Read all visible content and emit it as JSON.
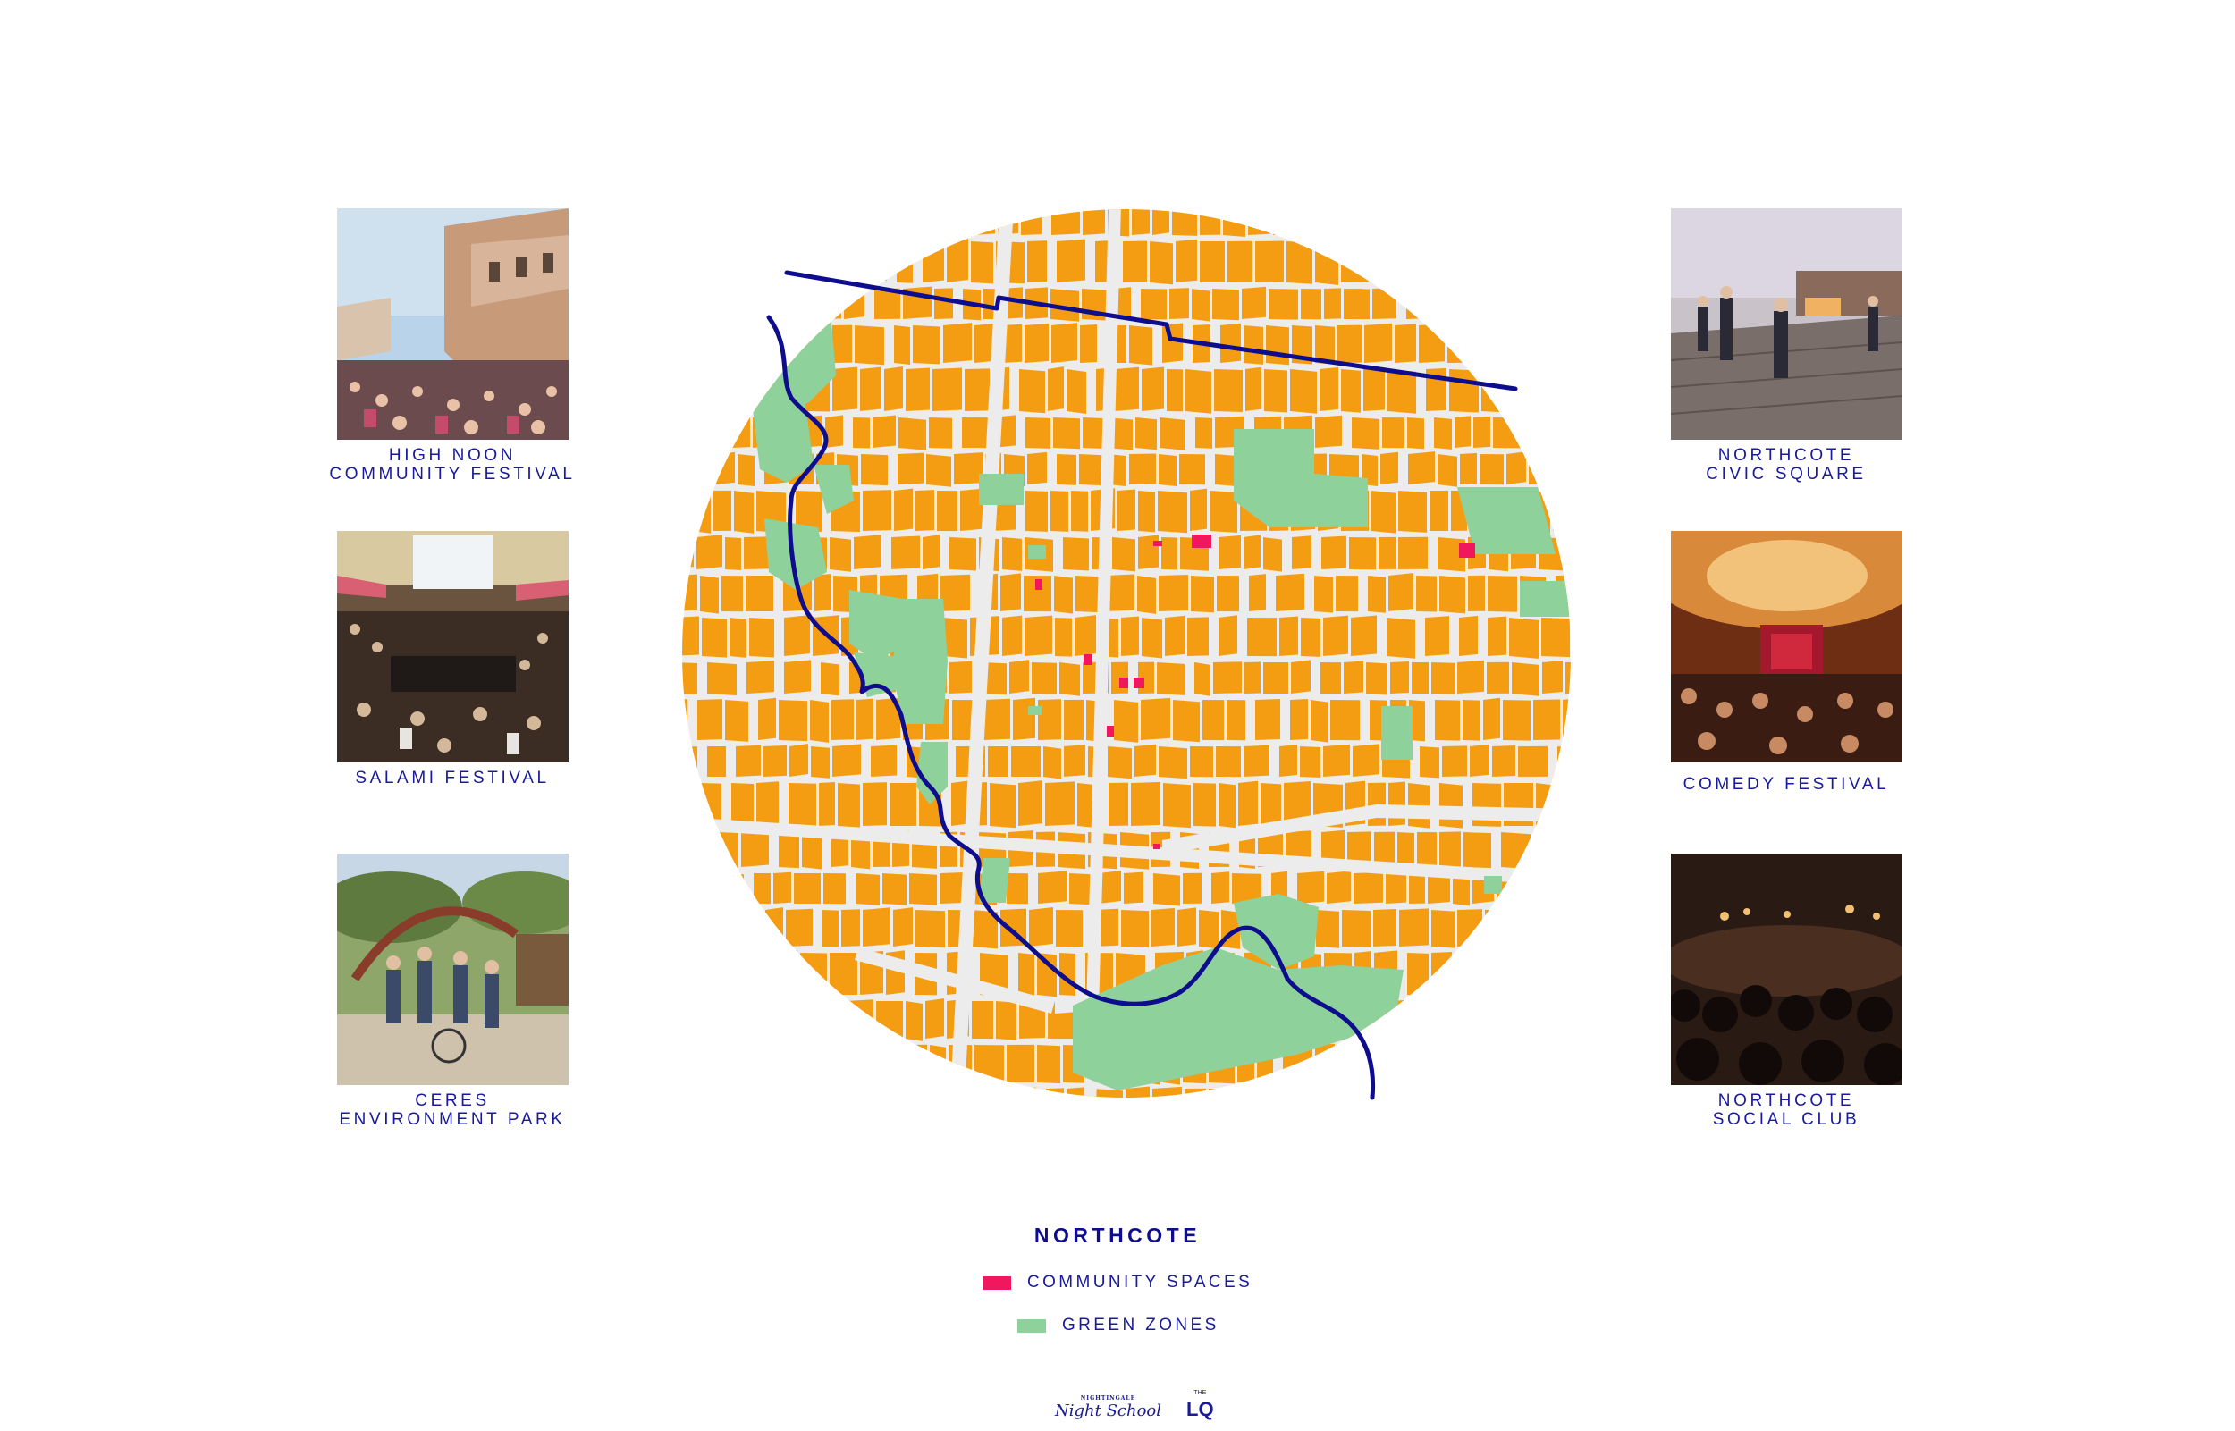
{
  "colors": {
    "blocks": "#f59d12",
    "roads": "#ececec",
    "community_spaces": "#f0175e",
    "green_zones": "#8fd19a",
    "river_and_boundary": "#0d0d8e",
    "text": "#1a1a9c"
  },
  "map": {
    "features": [
      "street-block-grid",
      "river",
      "suburb-boundary",
      "green-zones",
      "community-spaces"
    ]
  },
  "venues_left": [
    {
      "line1": "HIGH NOON",
      "line2": "COMMUNITY FESTIVAL",
      "photo": "street-festival-crowd"
    },
    {
      "line1": "SALAMI FESTIVAL",
      "line2": "",
      "photo": "hall-market-crowd"
    },
    {
      "line1": "CERES",
      "line2": "ENVIRONMENT PARK",
      "photo": "garden-gateway"
    }
  ],
  "venues_right": [
    {
      "line1": "NORTHCOTE",
      "line2": "CIVIC SQUARE",
      "photo": "boardwalk-square-dusk"
    },
    {
      "line1": "COMEDY FESTIVAL",
      "line2": "",
      "photo": "theatre-stage-audience"
    },
    {
      "line1": "NORTHCOTE",
      "line2": "SOCIAL CLUB",
      "photo": "dark-concert-crowd"
    }
  ],
  "legend": {
    "title": "NORTHCOTE",
    "items": [
      {
        "label": "COMMUNITY SPACES",
        "color": "#f0175e"
      },
      {
        "label": "GREEN ZONES",
        "color": "#8fd19a"
      }
    ]
  },
  "logos": {
    "nightingale_small": "NIGHTINGALE",
    "nightschool": "Night School",
    "lq_small": "THE",
    "lq": "LQ"
  }
}
